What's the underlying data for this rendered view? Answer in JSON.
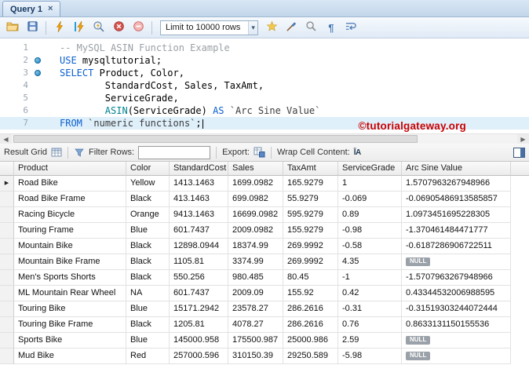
{
  "tab": {
    "title": "Query 1",
    "close": "×"
  },
  "toolbar": {
    "limit_dropdown": "Limit to 10000 rows"
  },
  "editor": {
    "lines": [
      {
        "num": "1",
        "marker": false,
        "current": false,
        "segments": [
          {
            "t": "-- MySQL ASIN Function Example",
            "c": "comment"
          }
        ]
      },
      {
        "num": "2",
        "marker": true,
        "current": false,
        "segments": [
          {
            "t": "USE",
            "c": "keyword"
          },
          {
            "t": " mysqltutorial;",
            "c": "plain"
          }
        ]
      },
      {
        "num": "3",
        "marker": true,
        "current": false,
        "segments": [
          {
            "t": "SELECT",
            "c": "keyword"
          },
          {
            "t": " Product, Color,",
            "c": "plain"
          }
        ]
      },
      {
        "num": "4",
        "marker": false,
        "current": false,
        "segments": [
          {
            "t": "        StandardCost, Sales, TaxAmt,",
            "c": "plain"
          }
        ]
      },
      {
        "num": "5",
        "marker": false,
        "current": false,
        "segments": [
          {
            "t": "        ServiceGrade,",
            "c": "plain"
          }
        ]
      },
      {
        "num": "6",
        "marker": false,
        "current": false,
        "segments": [
          {
            "t": "        ",
            "c": "plain"
          },
          {
            "t": "ASIN",
            "c": "function"
          },
          {
            "t": "(ServiceGrade) ",
            "c": "plain"
          },
          {
            "t": "AS",
            "c": "keyword"
          },
          {
            "t": " ",
            "c": "plain"
          },
          {
            "t": "`Arc Sine Value`",
            "c": "ident"
          }
        ]
      },
      {
        "num": "7",
        "marker": false,
        "current": true,
        "cursor": true,
        "segments": [
          {
            "t": "FROM",
            "c": "keyword"
          },
          {
            "t": " ",
            "c": "plain"
          },
          {
            "t": "`numeric functions`",
            "c": "ident"
          },
          {
            "t": ";",
            "c": "plain"
          }
        ]
      }
    ]
  },
  "watermark": "©tutorialgateway.org",
  "result_toolbar": {
    "grid_label": "Result Grid",
    "filter_label": "Filter Rows:",
    "filter_value": "",
    "export_label": "Export:",
    "wrap_label": "Wrap Cell Content:",
    "wrap_icon_text": "ĪA"
  },
  "grid": {
    "columns": [
      "Product",
      "Color",
      "StandardCost",
      "Sales",
      "TaxAmt",
      "ServiceGrade",
      "Arc Sine Value"
    ],
    "rows": [
      [
        "Road Bike",
        "Yellow",
        "1413.1463",
        "1699.0982",
        "165.9279",
        "1",
        "1.5707963267948966"
      ],
      [
        "Road Bike Frame",
        "Black",
        "413.1463",
        "699.0982",
        "55.9279",
        "-0.069",
        "-0.06905486913585857"
      ],
      [
        "Racing Bicycle",
        "Orange",
        "9413.1463",
        "16699.0982",
        "595.9279",
        "0.89",
        "1.0973451695228305"
      ],
      [
        "Touring Frame",
        "Blue",
        "601.7437",
        "2009.0982",
        "155.9279",
        "-0.98",
        "-1.370461484471777"
      ],
      [
        "Mountain Bike",
        "Black",
        "12898.0944",
        "18374.99",
        "269.9992",
        "-0.58",
        "-0.6187286906722511"
      ],
      [
        "Mountain Bike Frame",
        "Black",
        "1105.81",
        "3374.99",
        "269.9992",
        "4.35",
        "NULL"
      ],
      [
        "Men's Sports Shorts",
        "Black",
        "550.256",
        "980.485",
        "80.45",
        "-1",
        "-1.5707963267948966"
      ],
      [
        "ML Mountain Rear Wheel",
        "NA",
        "601.7437",
        "2009.09",
        "155.92",
        "0.42",
        "0.43344532006988595"
      ],
      [
        "Touring Bike",
        "Blue",
        "15171.2942",
        "23578.27",
        "286.2616",
        "-0.31",
        "-0.31519303244072444"
      ],
      [
        "Touring Bike Frame",
        "Black",
        "1205.81",
        "4078.27",
        "286.2616",
        "0.76",
        "0.8633131150155536"
      ],
      [
        "Sports Bike",
        "Blue",
        "145000.958",
        "175500.987",
        "25000.986",
        "2.59",
        "NULL"
      ],
      [
        "Mud Bike",
        "Red",
        "257000.596",
        "310150.39",
        "29250.589",
        "-5.98",
        "NULL"
      ]
    ]
  },
  "colors": {
    "keyword_blue": "#0b5fd0",
    "function_teal": "#00838f",
    "comment_gray": "#9aa0a6",
    "watermark_red": "#cc0000",
    "null_badge": "#9aa1a8",
    "line_highlight": "#dff0fb"
  }
}
